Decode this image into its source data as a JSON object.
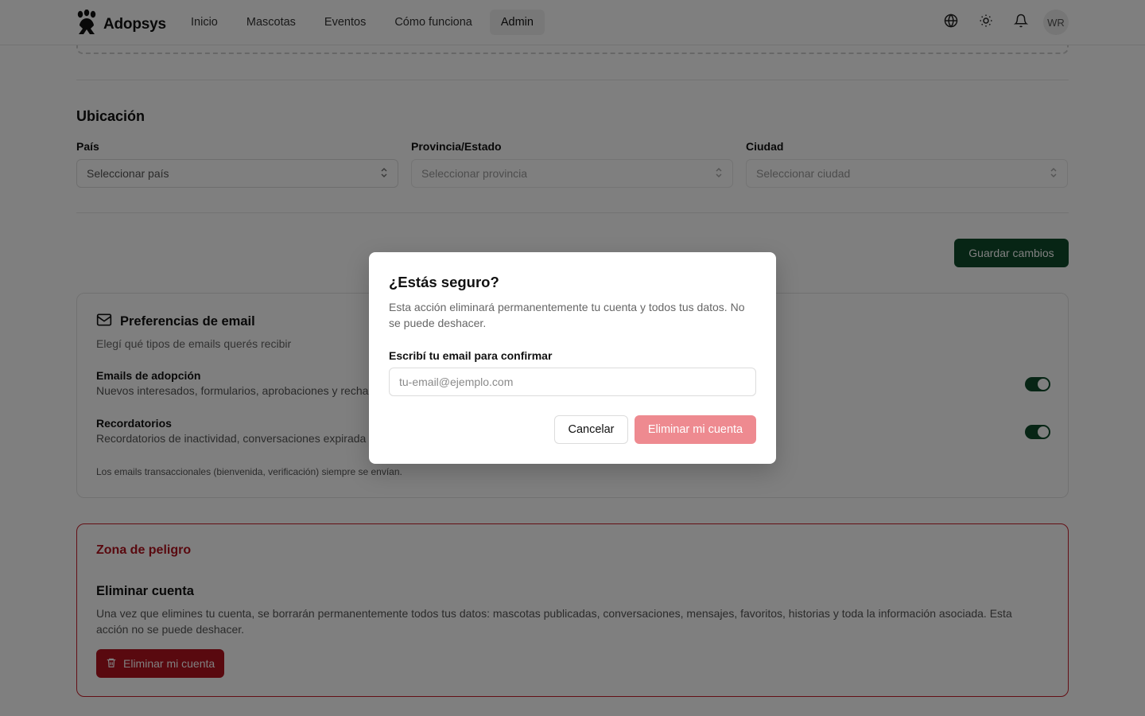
{
  "header": {
    "brand": "Adopsys",
    "nav": [
      {
        "label": "Inicio"
      },
      {
        "label": "Mascotas"
      },
      {
        "label": "Eventos"
      },
      {
        "label": "Cómo funciona"
      },
      {
        "label": "Admin",
        "active": true
      }
    ],
    "avatar_initials": "WR",
    "icons": [
      "globe-icon",
      "sun-icon",
      "bell-icon"
    ]
  },
  "location": {
    "title": "Ubicación",
    "fields": [
      {
        "label": "País",
        "value": "Seleccionar país",
        "disabled": false
      },
      {
        "label": "Provincia/Estado",
        "value": "Seleccionar provincia",
        "disabled": true
      },
      {
        "label": "Ciudad",
        "value": "Seleccionar ciudad",
        "disabled": true
      }
    ]
  },
  "save_label": "Guardar cambios",
  "email_prefs": {
    "title": "Preferencias de email",
    "description": "Elegí qué tipos de emails querés recibir",
    "items": [
      {
        "title": "Emails de adopción",
        "description": "Nuevos interesados, formularios, aprobaciones y recha",
        "enabled": true
      },
      {
        "title": "Recordatorios",
        "description": "Recordatorios de inactividad, conversaciones expirada",
        "enabled": true
      }
    ],
    "note": "Los emails transaccionales (bienvenida, verificación) siempre se envían."
  },
  "danger_zone": {
    "title": "Zona de peligro",
    "subtitle": "Eliminar cuenta",
    "description": "Una vez que elimines tu cuenta, se borrarán permanentemente todos tus datos: mascotas publicadas, conversaciones, mensajes, favoritos, historias y toda la información asociada. Esta acción no se puede deshacer.",
    "button_label": "Eliminar mi cuenta"
  },
  "dialog": {
    "title": "¿Estás seguro?",
    "description": "Esta acción eliminará permanentemente tu cuenta y todos tus datos. No se puede deshacer.",
    "input_label": "Escribí tu email para confirmar",
    "input_placeholder": "tu-email@ejemplo.com",
    "input_value": "",
    "cancel_label": "Cancelar",
    "confirm_label": "Eliminar mi cuenta"
  },
  "colors": {
    "primary": "#0e4a2a",
    "danger": "#b3121f",
    "danger_disabled": "#ee8a90"
  }
}
